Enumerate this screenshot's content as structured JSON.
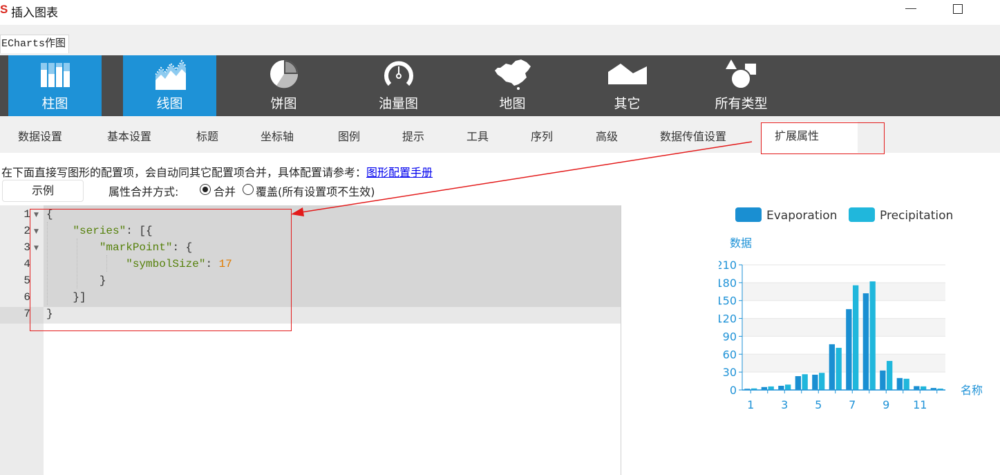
{
  "window": {
    "logo": "S",
    "title": "插入图表"
  },
  "outer_tab": "ECharts作图",
  "chart_types": [
    {
      "label": "柱图",
      "icon": "bar-chart-icon",
      "active": true
    },
    {
      "label": "线图",
      "icon": "line-chart-icon",
      "active": true
    },
    {
      "label": "饼图",
      "icon": "pie-chart-icon",
      "active": false
    },
    {
      "label": "油量图",
      "icon": "gauge-icon",
      "active": false
    },
    {
      "label": "地图",
      "icon": "map-icon",
      "active": false
    },
    {
      "label": "其它",
      "icon": "other-chart-icon",
      "active": false
    },
    {
      "label": "所有类型",
      "icon": "all-types-icon",
      "active": false
    }
  ],
  "settings_tabs": [
    "数据设置",
    "基本设置",
    "标题",
    "坐标轴",
    "图例",
    "提示",
    "工具",
    "序列",
    "高级",
    "数据传值设置",
    "扩展属性"
  ],
  "active_settings_tab": "扩展属性",
  "instruction": {
    "text": "在下面直接写图形的配置项，会自动同其它配置项合并，具体配置请参考：",
    "link": "图形配置手册"
  },
  "example_button": "示例",
  "merge_mode": {
    "label": "属性合并方式:",
    "options": [
      "合并",
      "覆盖(所有设置项不生效)"
    ],
    "selected": "合并"
  },
  "editor": {
    "line_numbers": [
      "1",
      "2",
      "3",
      "4",
      "5",
      "6",
      "7"
    ],
    "lines": {
      "l1": "{",
      "l2_key": "\"series\"",
      "l2_rest": ": [{",
      "l3_key": "\"markPoint\"",
      "l3_rest": ": {",
      "l4_key": "\"symbolSize\"",
      "l4_colon": ": ",
      "l4_val": "17",
      "l5": "}",
      "l6": "}]",
      "l7": "}"
    }
  },
  "colors": {
    "accent": "#1e92d7",
    "evaporation": "#1a8fd2",
    "precipitation": "#20b7dc",
    "highlight": "#e31a1a"
  },
  "chart_data": {
    "type": "bar",
    "ylabel": "数据",
    "xlabel": "名称",
    "ylim": [
      0,
      210
    ],
    "yticks": [
      0,
      30,
      60,
      90,
      120,
      150,
      180,
      210
    ],
    "x": [
      1,
      2,
      3,
      4,
      5,
      6,
      7,
      8,
      9,
      10,
      11,
      12
    ],
    "xtick_labels": [
      "1",
      "3",
      "5",
      "7",
      "9",
      "11"
    ],
    "legend_position": "top",
    "series": [
      {
        "name": "Evaporation",
        "values": [
          2.0,
          4.9,
          7.0,
          23.2,
          25.6,
          76.7,
          135.6,
          162.2,
          32.6,
          20.0,
          6.4,
          3.3
        ]
      },
      {
        "name": "Precipitation",
        "values": [
          2.6,
          5.9,
          9.0,
          26.4,
          28.7,
          70.7,
          175.6,
          182.2,
          48.7,
          18.8,
          6.0,
          2.3
        ]
      }
    ]
  }
}
